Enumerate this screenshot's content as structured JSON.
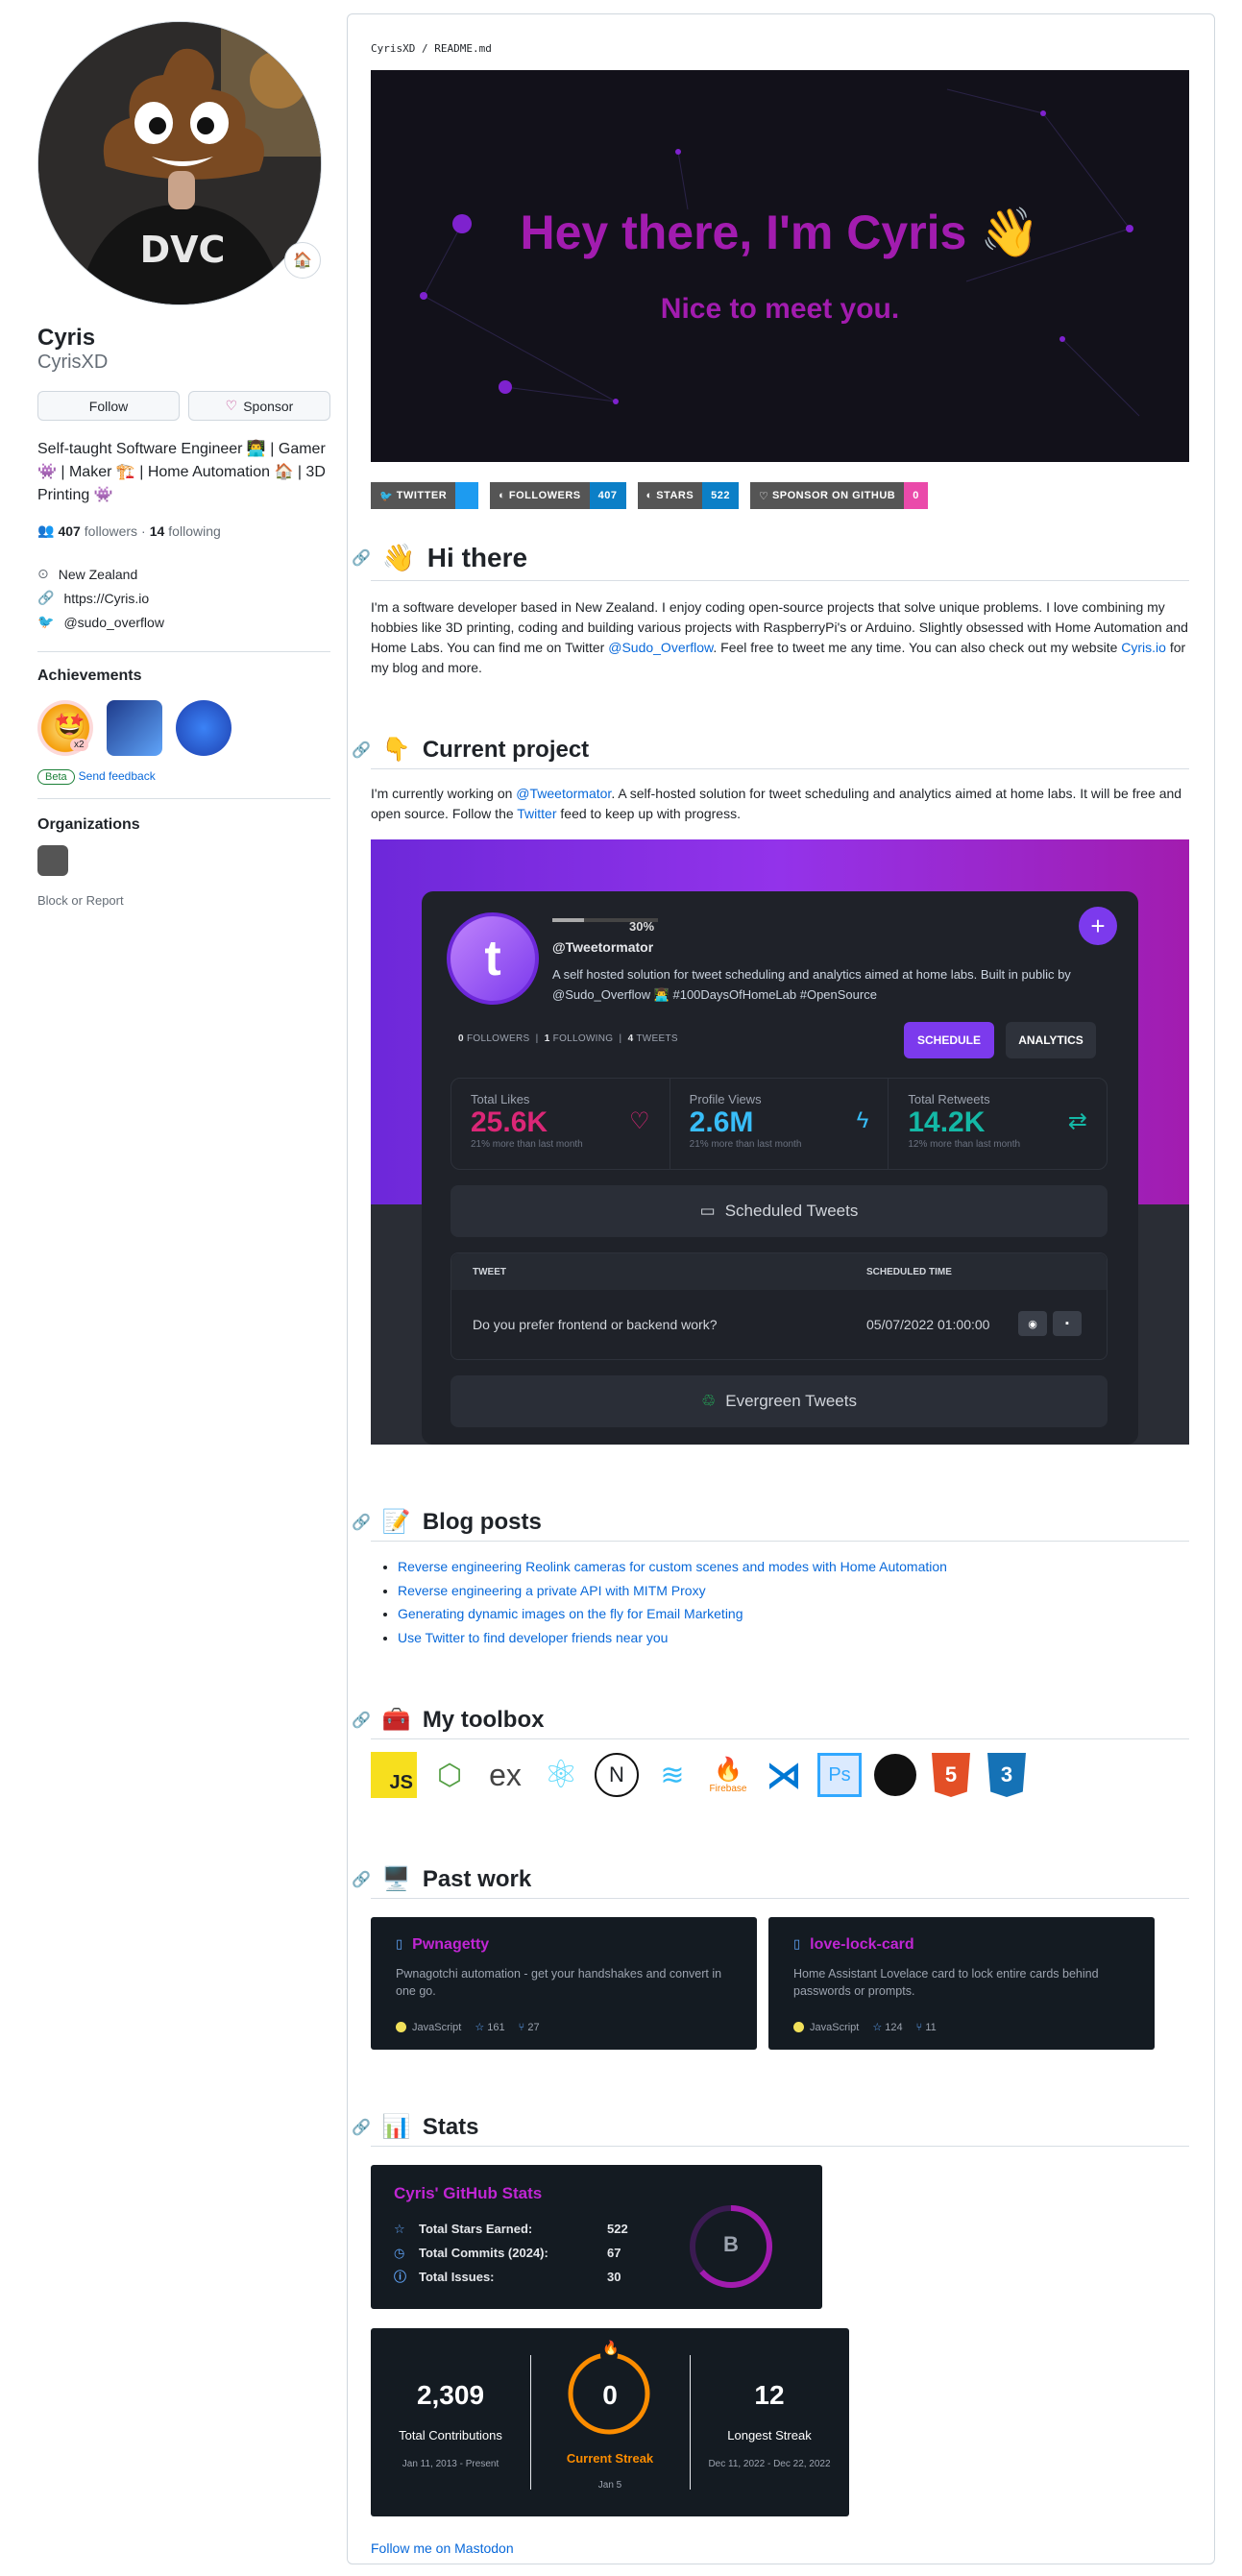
{
  "profile": {
    "name": "Cyris",
    "login": "CyrisXD",
    "follow_label": "Follow",
    "sponsor_label": "Sponsor",
    "bio": "Self-taught Software Engineer 👨‍💻 | Gamer 👾 | Maker 🏗️ | Home Automation 🏠 | 3D Printing 👾",
    "followers": "407",
    "followers_label": "followers",
    "following": "14",
    "following_label": "following",
    "location": "New Zealand",
    "website": "https://Cyris.io",
    "twitter": "@sudo_overflow",
    "achievements_title": "Achievements",
    "achievement_count": "x2",
    "beta_label": "Beta",
    "feedback_label": "Send feedback",
    "organizations_title": "Organizations",
    "block_label": "Block or Report"
  },
  "readme": {
    "breadcrumb": "CyrisXD / README.md",
    "banner_title": "Hey there, I'm Cyris 👋",
    "banner_subtitle": "Nice to meet you.",
    "shields": [
      {
        "label": "TWITTER",
        "value": "",
        "color": "#1d9bf0",
        "lcolor": "#555"
      },
      {
        "label": "FOLLOWERS",
        "value": "407",
        "color": "#0b7fc7",
        "lcolor": "#555"
      },
      {
        "label": "STARS",
        "value": "522",
        "color": "#0b7fc7",
        "lcolor": "#555"
      },
      {
        "label": "SPONSOR ON GITHUB",
        "value": "0",
        "color": "#ea4aaa",
        "lcolor": "#555"
      }
    ],
    "hi_title": "Hi there",
    "hi_emoji": "👋",
    "hi_text_1": "I'm a software developer based in New Zealand. I enjoy coding open-source projects that solve unique problems. I love combining my hobbies like 3D printing, coding and building various projects with RaspberryPi's or Arduino. Slightly obsessed with Home Automation and Home Labs. You can find me on Twitter ",
    "hi_link_twitter": "@Sudo_Overflow",
    "hi_text_2": ". Feel free to tweet me any time. You can also check out my website ",
    "hi_link_site": "Cyris.io",
    "hi_text_3": " for my blog and more.",
    "cp_title": "Current project",
    "cp_emoji": "👇",
    "cp_text_1": "I'm currently working on ",
    "cp_link_1": "@Tweetormator",
    "cp_text_2": ". A self-hosted solution for tweet scheduling and analytics aimed at home labs. It will be free and open source. Follow the ",
    "cp_link_2": "Twitter",
    "cp_text_3": " feed to keep up with progress.",
    "blog_title": "Blog posts",
    "blog_emoji": "📝",
    "blog_posts": [
      "Reverse engineering Reolink cameras for custom scenes and modes with Home Automation",
      "Reverse engineering a private API with MITM Proxy",
      "Generating dynamic images on the fly for Email Marketing",
      "Use Twitter to find developer friends near you"
    ],
    "toolbox_title": "My toolbox",
    "toolbox_emoji": "🧰",
    "firebase_label": "Firebase",
    "past_title": "Past work",
    "past_emoji": "🖥️",
    "stats_title": "Stats",
    "stats_emoji": "📊",
    "mastodon": "Follow me on Mastodon"
  },
  "tweetormator": {
    "progress_text": "30%",
    "handle": "@Tweetormator",
    "progress": 0.3,
    "desc": "A self hosted solution for tweet scheduling and analytics aimed at home labs. Built in public by @Sudo_Overflow 👨‍💻 #100DaysOfHomeLab #OpenSource",
    "followers": "0",
    "followers_label": "FOLLOWERS",
    "following": "1",
    "following_label": "FOLLOWING",
    "tweets": "4",
    "tweets_label": "TWEETS",
    "schedule_btn": "SCHEDULE",
    "analytics_btn": "ANALYTICS",
    "stats": [
      {
        "label": "Total Likes",
        "value": "25.6K",
        "sub": "21% more than last month",
        "color": "#db2777"
      },
      {
        "label": "Profile Views",
        "value": "2.6M",
        "sub": "21% more than last month",
        "color": "#38bdf8"
      },
      {
        "label": "Total Retweets",
        "value": "14.2K",
        "sub": "12% more than last month",
        "color": "#14b8a6"
      }
    ],
    "scheduled_label": "Scheduled Tweets",
    "col_tweet": "TWEET",
    "col_time": "SCHEDULED TIME",
    "row_tweet": "Do you prefer frontend or backend work?",
    "row_time": "05/07/2022 01:00:00",
    "evergreen_label": "Evergreen Tweets"
  },
  "repos": [
    {
      "name": "Pwnagetty",
      "desc": "Pwnagotchi automation - get your handshakes and convert in one go.",
      "lang": "JavaScript",
      "stars": "161",
      "forks": "27"
    },
    {
      "name": "love-lock-card",
      "desc": "Home Assistant Lovelace card to lock entire cards behind passwords or prompts.",
      "lang": "JavaScript",
      "stars": "124",
      "forks": "11"
    }
  ],
  "gh_stats": {
    "title": "Cyris' GitHub Stats",
    "rows": [
      {
        "label": "Total Stars Earned:",
        "value": "522"
      },
      {
        "label": "Total Commits (2024):",
        "value": "67"
      },
      {
        "label": "Total Issues:",
        "value": "30"
      }
    ],
    "grade": "B"
  },
  "streak": {
    "total": "2,309",
    "total_label": "Total Contributions",
    "total_range": "Jan 11, 2013 - Present",
    "current": "0",
    "current_label": "Current Streak",
    "current_range": "Jan 5",
    "longest": "12",
    "longest_label": "Longest Streak",
    "longest_range": "Dec 11, 2022 - Dec 22, 2022"
  }
}
